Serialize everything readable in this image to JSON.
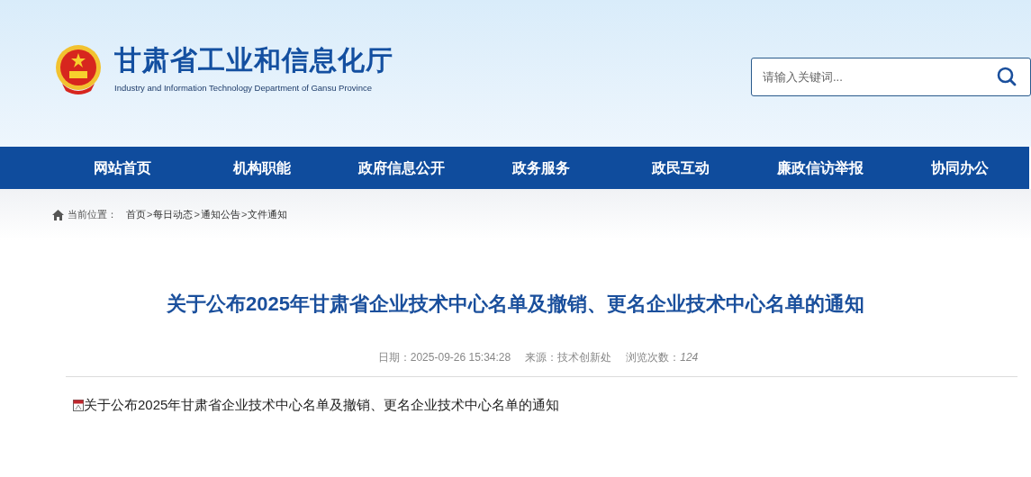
{
  "header": {
    "title": "甘肃省工业和信息化厅",
    "subtitle": "Industry and Information Technology Department of Gansu Province",
    "search": {
      "placeholder": "请输入关键词..."
    }
  },
  "nav": {
    "items": [
      {
        "label": "网站首页"
      },
      {
        "label": "机构职能"
      },
      {
        "label": "政府信息公开"
      },
      {
        "label": "政务服务"
      },
      {
        "label": "政民互动"
      },
      {
        "label": "廉政信访举报"
      },
      {
        "label": "协同办公"
      }
    ]
  },
  "breadcrumb": {
    "label": "当前位置：",
    "separator": ">",
    "items": [
      "首页",
      "每日动态",
      "通知公告",
      "文件通知"
    ]
  },
  "article": {
    "title": "关于公布2025年甘肃省企业技术中心名单及撤销、更名企业技术中心名单的通知",
    "meta": [
      {
        "label": "日期：",
        "value": "2025-09-26 15:34:28",
        "italic": false
      },
      {
        "label": "来源：",
        "value": "技术创新处",
        "italic": false
      },
      {
        "label": "浏览次数：",
        "value": "124",
        "italic": true
      }
    ],
    "attachments": [
      {
        "label": "关于公布2025年甘肃省企业技术中心名单及撤销、更名企业技术中心名单的通知"
      }
    ]
  }
}
